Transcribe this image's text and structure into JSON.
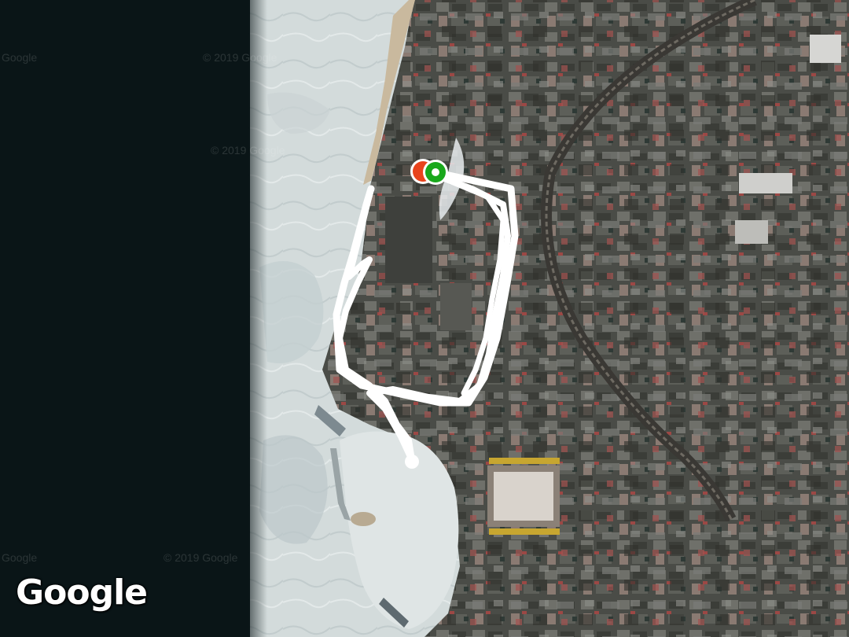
{
  "map": {
    "type": "satellite",
    "branding": "Google",
    "tile_watermarks": [
      "© 2019 Google",
      "Google"
    ],
    "colors": {
      "no_imagery": "#0a1517",
      "sea_ice": "#d4dcdc",
      "city": "#4d4f4a",
      "route": "#ffffff",
      "start_marker": "#19a81c",
      "end_marker": "#e8431c"
    }
  },
  "route": {
    "markers": [
      {
        "role": "start",
        "color_name": "green",
        "icon": "circle-marker-icon"
      },
      {
        "role": "end",
        "color_name": "red",
        "icon": "circle-marker-icon"
      }
    ]
  }
}
